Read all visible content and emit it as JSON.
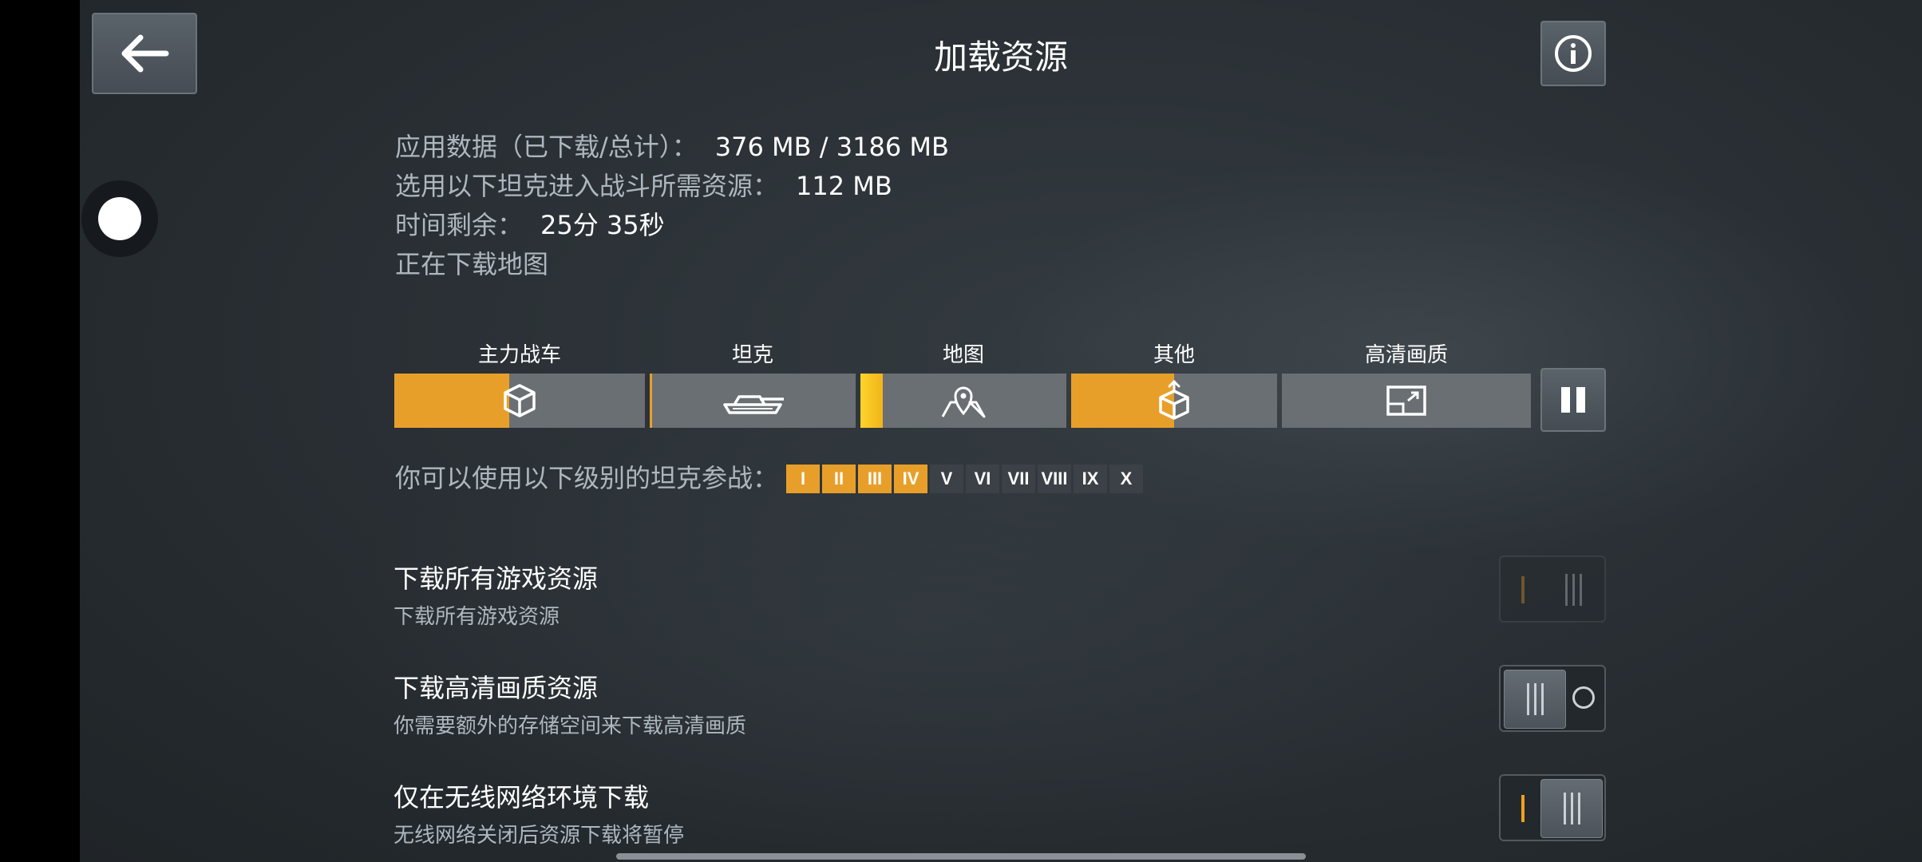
{
  "header": {
    "title": "加载资源",
    "back_icon": "arrow-left-icon",
    "info_icon": "info-icon"
  },
  "info": {
    "app_data_label": "应用数据（已下载/总计）：",
    "app_data_value": "376 MB / 3186 MB",
    "tank_required_label": "选用以下坦克进入战斗所需资源：",
    "tank_required_value": "112 MB",
    "time_left_label": "时间剩余：",
    "time_left_value": "25分 35秒",
    "status": "正在下载地图"
  },
  "categories": [
    {
      "label": "主力战车",
      "icon": "cube-icon",
      "progress": 0.46
    },
    {
      "label": "坦克",
      "icon": "tank-icon",
      "progress": 0.01
    },
    {
      "label": "地图",
      "icon": "map-pin-icon",
      "progress": 0.11
    },
    {
      "label": "其他",
      "icon": "box-upload-icon",
      "progress": 0.5
    },
    {
      "label": "高清画质",
      "icon": "hd-screen-icon",
      "progress": 0.0
    }
  ],
  "pause_icon": "pause-icon",
  "tiers": {
    "label": "你可以使用以下级别的坦克参战：",
    "items": [
      "I",
      "II",
      "III",
      "IV",
      "V",
      "VI",
      "VII",
      "VIII",
      "IX",
      "X"
    ],
    "enabled_count": 4
  },
  "settings": [
    {
      "title": "下载所有游戏资源",
      "subtitle": "下载所有游戏资源",
      "state": "disabled"
    },
    {
      "title": "下载高清画质资源",
      "subtitle": "你需要额外的存储空间来下载高清画质",
      "state": "off"
    },
    {
      "title": "仅在无线网络环境下载",
      "subtitle": "无线网络关闭后资源下载将暂停",
      "state": "on"
    }
  ],
  "colors": {
    "accent_orange": "#e89f2a",
    "map_yellow": "#ffd42a",
    "bar_gray": "#6a6f74",
    "background": "#2a3035"
  }
}
